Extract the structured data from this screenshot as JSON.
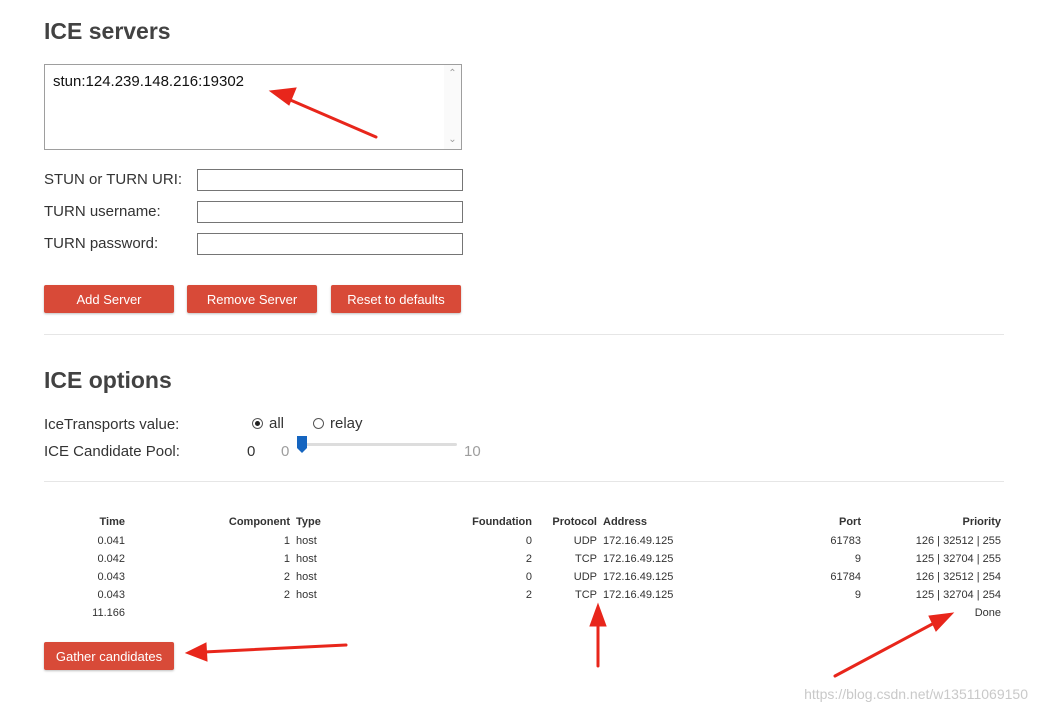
{
  "ice_servers": {
    "title": "ICE servers",
    "server_list": "stun:124.239.148.216:19302",
    "stun_label": "STUN or TURN URI:",
    "username_label": "TURN username:",
    "password_label": "TURN password:",
    "stun_value": "",
    "username_value": "",
    "password_value": "",
    "add_label": "Add Server",
    "remove_label": "Remove Server",
    "reset_label": "Reset to defaults"
  },
  "ice_options": {
    "title": "ICE options",
    "transports_label": "IceTransports value:",
    "transport_all": "all",
    "transport_relay": "relay",
    "transport_selected": "all",
    "pool_label": "ICE Candidate Pool:",
    "pool_value": "0",
    "pool_min": "0",
    "pool_max": "10"
  },
  "candidates": {
    "headers": {
      "time": "Time",
      "component": "Component",
      "type": "Type",
      "foundation": "Foundation",
      "protocol": "Protocol",
      "address": "Address",
      "port": "Port",
      "priority": "Priority"
    },
    "rows": [
      {
        "time": "0.041",
        "component": "1",
        "type": "host",
        "foundation": "0",
        "protocol": "UDP",
        "address": "172.16.49.125",
        "port": "61783",
        "priority": "126 | 32512 | 255"
      },
      {
        "time": "0.042",
        "component": "1",
        "type": "host",
        "foundation": "2",
        "protocol": "TCP",
        "address": "172.16.49.125",
        "port": "9",
        "priority": "125 | 32704 | 255"
      },
      {
        "time": "0.043",
        "component": "2",
        "type": "host",
        "foundation": "0",
        "protocol": "UDP",
        "address": "172.16.49.125",
        "port": "61784",
        "priority": "126 | 32512 | 254"
      },
      {
        "time": "0.043",
        "component": "2",
        "type": "host",
        "foundation": "2",
        "protocol": "TCP",
        "address": "172.16.49.125",
        "port": "9",
        "priority": "125 | 32704 | 254"
      }
    ],
    "final_time": "11.166",
    "final_status": "Done",
    "gather_label": "Gather candidates"
  },
  "watermark": "https://blog.csdn.net/w13511069150",
  "colors": {
    "button": "#d84a38",
    "arrow": "#e8261b",
    "slider_thumb": "#1565c0"
  }
}
